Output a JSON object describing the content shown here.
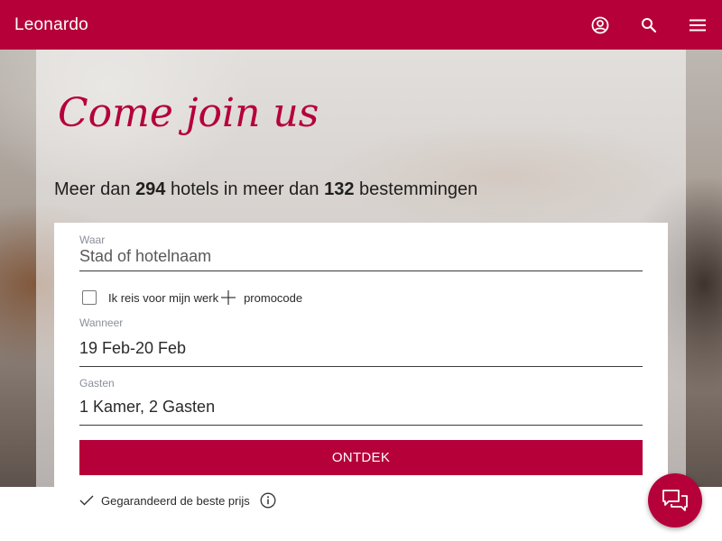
{
  "header": {
    "brand": "Leonardo",
    "icons": [
      "account-icon",
      "search-icon",
      "menu-icon"
    ]
  },
  "hero": {
    "script_heading": "Come join us",
    "tagline": {
      "part1": "Meer dan ",
      "hotels_count": "294",
      "part2": " hotels in meer dan ",
      "destinations_count": "132",
      "part3": " bestemmingen"
    }
  },
  "search_form": {
    "where": {
      "label": "Waar",
      "placeholder": "Stad of hotelnaam"
    },
    "work_trip_label": "Ik reis voor mijn werk",
    "promocode_label": "promocode",
    "when": {
      "label": "Wanneer",
      "value": "19 Feb-20 Feb"
    },
    "guests": {
      "label": "Gasten",
      "value": "1 Kamer, 2 Gasten"
    },
    "submit_label": "ONTDEK",
    "guarantee_label": "Gegarandeerd de beste prijs"
  },
  "chat": {
    "icon": "chat-icon"
  },
  "colors": {
    "brand": "#b5003a",
    "text": "#2a2a2a",
    "label": "#8b8f99"
  }
}
